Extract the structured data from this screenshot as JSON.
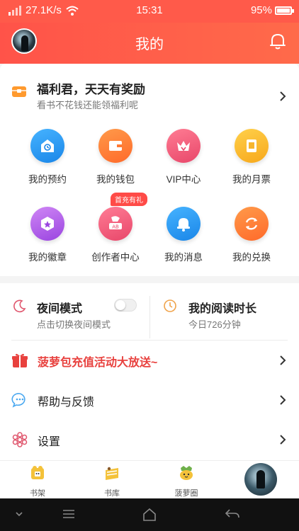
{
  "status_bar": {
    "speed": "27.1K/s",
    "time": "15:31",
    "battery": "95%",
    "battery_level": 0.95
  },
  "header": {
    "title": "我的"
  },
  "welfare": {
    "title": "福利君，天天有奖励",
    "subtitle": "看书不花钱还能领福利呢"
  },
  "grid": {
    "badge": "首充有礼",
    "items": [
      {
        "label": "我的预约",
        "icon": "calendar-clock-icon",
        "color": "#2e9bf0"
      },
      {
        "label": "我的钱包",
        "icon": "wallet-icon",
        "color": "#ff7a35"
      },
      {
        "label": "VIP中心",
        "icon": "crown-icon",
        "color": "#f05a7a"
      },
      {
        "label": "我的月票",
        "icon": "ticket-icon",
        "color": "#f7b52c"
      },
      {
        "label": "我的徽章",
        "icon": "badge-star-icon",
        "color": "#b15ee6"
      },
      {
        "label": "创作者中心",
        "icon": "writer-icon",
        "color": "#f2577a"
      },
      {
        "label": "我的消息",
        "icon": "bell-icon",
        "color": "#2e9bf0"
      },
      {
        "label": "我的兑换",
        "icon": "exchange-icon",
        "color": "#ff7a35"
      }
    ]
  },
  "settings": {
    "night_title": "夜间模式",
    "night_sub": "点击切换夜间模式",
    "night_on": false,
    "read_title": "我的阅读时长",
    "read_sub": "今日726分钟",
    "promo": "菠萝包充值活动大放送~",
    "help": "帮助与反馈",
    "settings": "设置"
  },
  "tabs": [
    {
      "label": "书架",
      "icon": "bookshelf-icon"
    },
    {
      "label": "书库",
      "icon": "library-icon"
    },
    {
      "label": "菠萝圈",
      "icon": "pineapple-icon"
    }
  ],
  "colors": {
    "accent": "#ff5a4a",
    "promo_text": "#e8413e"
  }
}
